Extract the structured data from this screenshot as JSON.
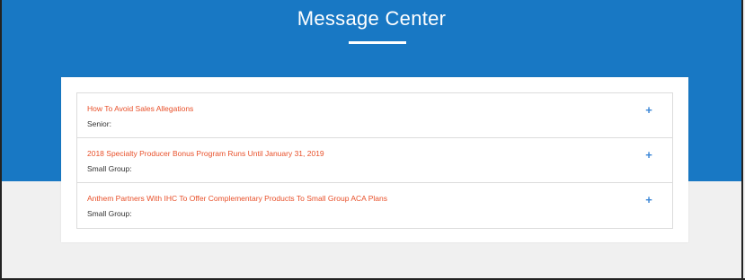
{
  "header": {
    "title": "Message Center"
  },
  "messages": [
    {
      "title": "How To Avoid Sales Allegations",
      "category": "Senior:",
      "expand_icon": "+"
    },
    {
      "title": "2018 Specialty Producer Bonus Program Runs Until January 31, 2019",
      "category": "Small Group:",
      "expand_icon": "+"
    },
    {
      "title": "Anthem Partners With IHC To Offer Complementary Products To Small Group ACA Plans",
      "category": "Small Group:",
      "expand_icon": "+"
    }
  ],
  "colors": {
    "hero_blue": "#1878c4",
    "link_orange": "#e8502a",
    "icon_blue": "#3b86d6"
  }
}
